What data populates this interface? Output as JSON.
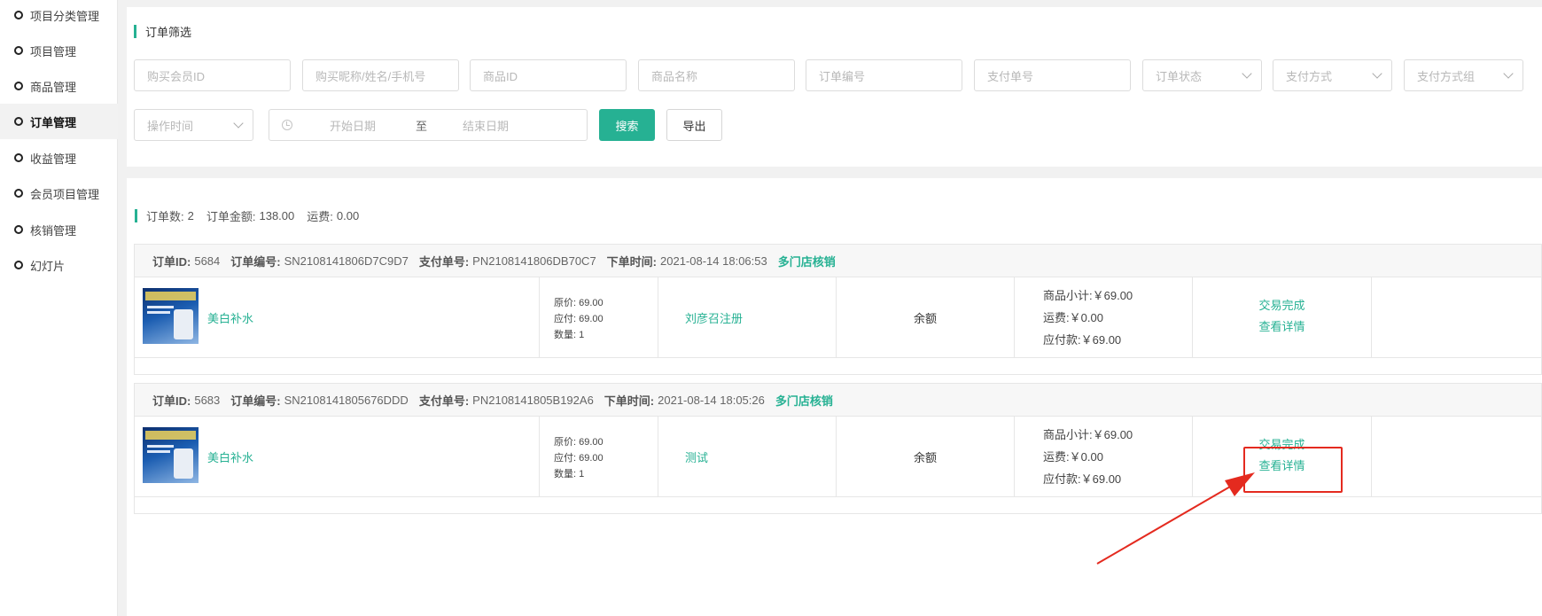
{
  "sidebar": {
    "items": [
      {
        "label": "项目分类管理"
      },
      {
        "label": "项目管理"
      },
      {
        "label": "商品管理"
      },
      {
        "label": "订单管理",
        "active": true
      },
      {
        "label": "收益管理"
      },
      {
        "label": "会员项目管理"
      },
      {
        "label": "核销管理"
      },
      {
        "label": "幻灯片"
      }
    ]
  },
  "filter": {
    "title": "订单筛选",
    "member_id": "购买会员ID",
    "nickname": "购买昵称/姓名/手机号",
    "product_id": "商品ID",
    "product_name": "商品名称",
    "order_no": "订单编号",
    "pay_no": "支付单号",
    "order_status": "订单状态",
    "pay_method": "支付方式",
    "pay_group": "支付方式组",
    "op_time": "操作时间",
    "start_date": "开始日期",
    "to": "至",
    "end_date": "结束日期",
    "search_label": "搜索",
    "export_label": "导出"
  },
  "summary": {
    "count_label": "订单数:",
    "count": "2",
    "amount_label": "订单金额:",
    "amount": "138.00",
    "freight_label": "运费:",
    "freight": "0.00"
  },
  "labels": {
    "order_id": "订单ID:",
    "order_no": "订单编号:",
    "pay_no": "支付单号:",
    "order_time": "下单时间:",
    "orig_price": "原价:",
    "due_price": "应付:",
    "qty": "数量:",
    "subtotal": "商品小计:",
    "freight": "运费:",
    "payable": "应付款:"
  },
  "orders": [
    {
      "id": "5684",
      "order_no": "SN2108141806D7C9D7",
      "pay_no": "PN2108141806DB70C7",
      "time": "2021-08-14 18:06:53",
      "tag": "多门店核销",
      "product": "美白补水",
      "orig_price": "69.00",
      "due_price": "69.00",
      "qty": "1",
      "buyer": "刘彦召注册",
      "pay_method": "余额",
      "subtotal": "￥69.00",
      "freight": "￥0.00",
      "payable": "￥69.00",
      "status": "交易完成",
      "detail": "查看详情"
    },
    {
      "id": "5683",
      "order_no": "SN2108141805676DDD",
      "pay_no": "PN2108141805B192A6",
      "time": "2021-08-14 18:05:26",
      "tag": "多门店核销",
      "product": "美白补水",
      "orig_price": "69.00",
      "due_price": "69.00",
      "qty": "1",
      "buyer": "测试",
      "pay_method": "余额",
      "subtotal": "￥69.00",
      "freight": "￥0.00",
      "payable": "￥69.00",
      "status": "交易完成",
      "detail": "查看详情"
    }
  ],
  "colors": {
    "accent": "#26b193",
    "annotation": "#e42a1f"
  }
}
